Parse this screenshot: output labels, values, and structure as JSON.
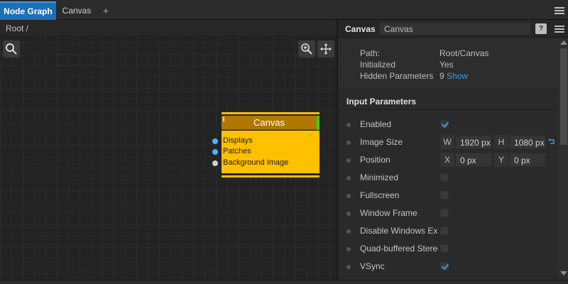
{
  "tabs": [
    {
      "label": "Node Graph",
      "active": true
    },
    {
      "label": "Canvas",
      "active": false
    }
  ],
  "tab_add_label": "+",
  "graph": {
    "breadcrumb": "Root  /",
    "node": {
      "title": "Canvas",
      "ports": [
        {
          "label": "Displays",
          "color": "#4fb3ff"
        },
        {
          "label": "Patches",
          "color": "#4fb3ff"
        },
        {
          "label": "Background Image",
          "color": "#d0d0d0"
        }
      ]
    }
  },
  "inspector": {
    "title": "Canvas",
    "name_value": "Canvas",
    "help_label": "?",
    "info": [
      {
        "key": "Path:",
        "value": "Root/Canvas"
      },
      {
        "key": "Initialized",
        "value": "Yes"
      },
      {
        "key": "Hidden Parameters",
        "value": "9",
        "link": "Show"
      }
    ],
    "section_title": "Input Parameters",
    "params": [
      {
        "label": "Enabled",
        "type": "checkbox",
        "checked": true
      },
      {
        "label": "Image Size",
        "type": "pair",
        "a_tag": "W",
        "a_value": "1920 px",
        "b_tag": "H",
        "b_value": "1080 px"
      },
      {
        "label": "Position",
        "type": "pair",
        "a_tag": "X",
        "a_value": "0 px",
        "b_tag": "Y",
        "b_value": "0 px"
      },
      {
        "label": "Minimized",
        "type": "checkbox",
        "checked": false
      },
      {
        "label": "Fullscreen",
        "type": "checkbox",
        "checked": false
      },
      {
        "label": "Window Frame",
        "type": "checkbox",
        "checked": false
      },
      {
        "label": "Disable Windows Explorer",
        "type": "checkbox",
        "checked": false
      },
      {
        "label": "Quad-buffered Stereo",
        "type": "checkbox",
        "checked": false
      },
      {
        "label": "VSync",
        "type": "checkbox",
        "checked": true
      }
    ]
  },
  "colors": {
    "accent": "#1f6fb5",
    "node_body": "#ffc000",
    "node_header": "#b07800",
    "node_status": "#2ad32a",
    "link": "#3b9af0"
  }
}
